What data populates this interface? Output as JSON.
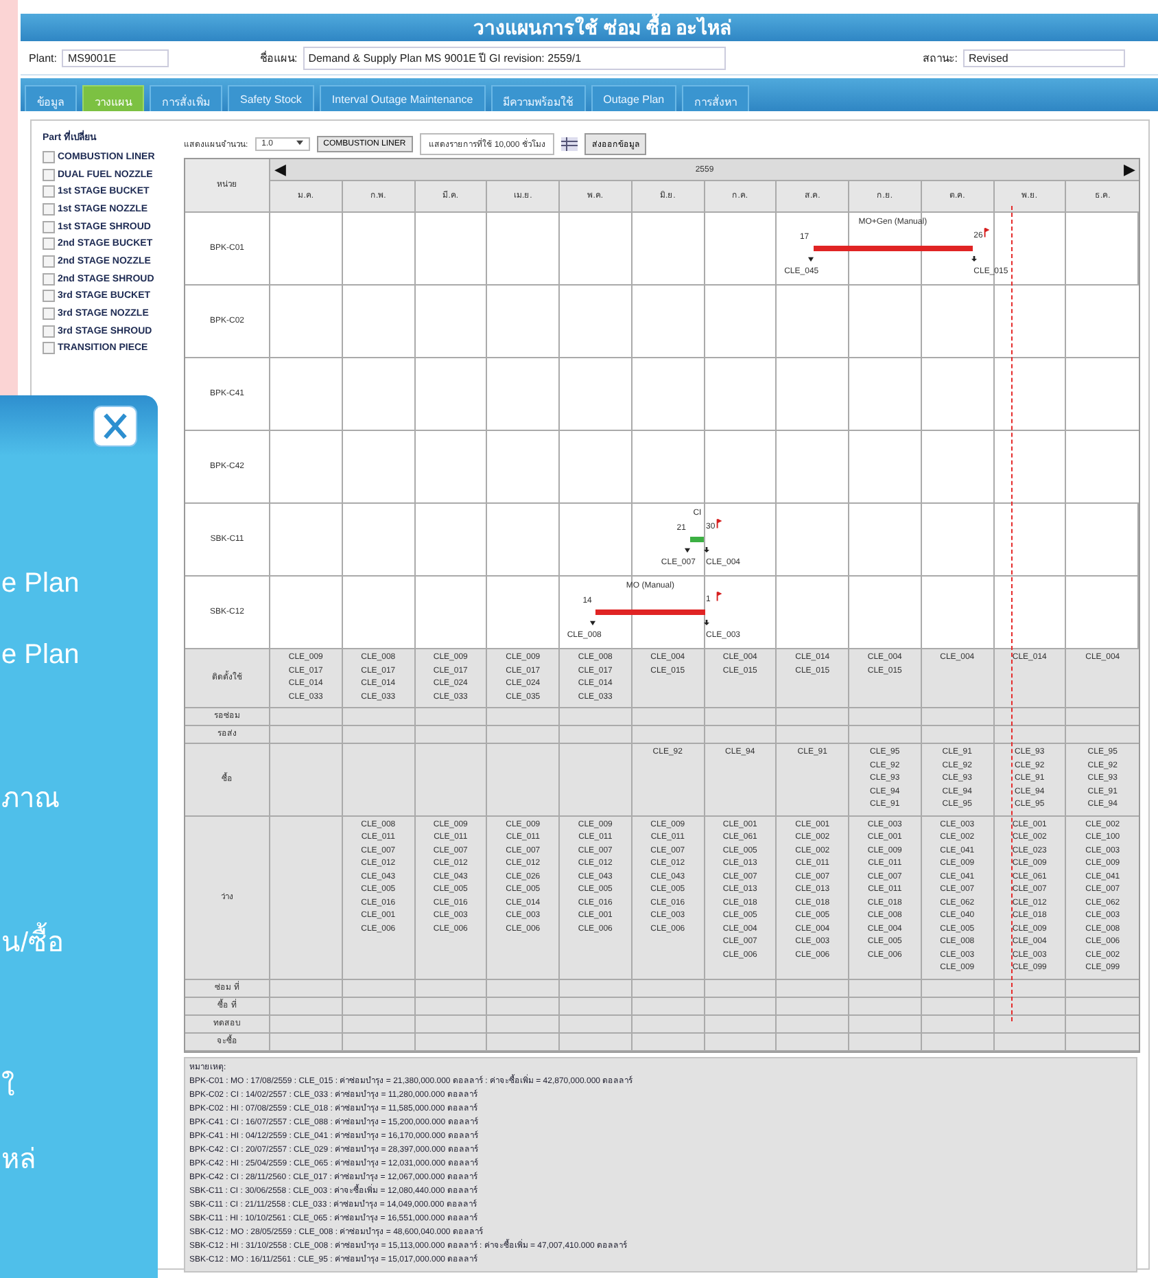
{
  "title": "วางแผนการใช้ ซ่อม ซื้อ อะไหล่",
  "info": {
    "plant_label": "Plant:",
    "plant": "MS9001E",
    "plan_label": "ชื่อแผน:",
    "plan": "Demand & Supply Plan MS 9001E ปี GI revision: 2559/1",
    "status_label": "สถานะ:",
    "status": "Revised"
  },
  "tabs": [
    {
      "label": "ข้อมูล",
      "selected": false
    },
    {
      "label": "วางแผน",
      "selected": true
    },
    {
      "label": "การสั่งเพิ่ม",
      "selected": false
    },
    {
      "label": "Safety Stock",
      "selected": false
    },
    {
      "label": "Interval Outage Maintenance",
      "selected": false
    },
    {
      "label": "มีความพร้อมใช้",
      "selected": false
    },
    {
      "label": "Outage Plan",
      "selected": false
    },
    {
      "label": "การสั่งหา",
      "selected": false
    }
  ],
  "parts": {
    "title": "Part ที่เปลี่ยน",
    "items": [
      {
        "label": "COMBUSTION LINER",
        "checked": false
      },
      {
        "label": "DUAL FUEL NOZZLE",
        "checked": false
      },
      {
        "label": "1st STAGE BUCKET",
        "checked": false
      },
      {
        "label": "1st STAGE NOZZLE",
        "checked": false
      },
      {
        "label": "1st STAGE SHROUD",
        "checked": false
      },
      {
        "label": "2nd STAGE BUCKET",
        "checked": false
      },
      {
        "label": "2nd STAGE NOZZLE",
        "checked": false
      },
      {
        "label": "2nd STAGE SHROUD",
        "checked": false
      },
      {
        "label": "3rd STAGE BUCKET",
        "checked": false
      },
      {
        "label": "3rd STAGE NOZZLE",
        "checked": false
      },
      {
        "label": "3rd STAGE SHROUD",
        "checked": false
      },
      {
        "label": "TRANSITION PIECE",
        "checked": false
      }
    ]
  },
  "toolbar": {
    "count_label": "แสดงแผนจำนวน:",
    "count": "1.0",
    "part_button": "COMBUSTION LINER",
    "hours_field": "แสดงรายการที่ใช้ 10,000 ชั่วโมง",
    "export_button": "ส่งออกข้อมูล"
  },
  "grid": {
    "unit_header": "หน่วย",
    "prev": "◀",
    "next": "▶",
    "year": "2559",
    "months": [
      {
        "label": "ม.ค.",
        "today": false
      },
      {
        "label": "ก.พ.",
        "today": false
      },
      {
        "label": "มี.ค.",
        "today": false
      },
      {
        "label": "เม.ย.",
        "today": false
      },
      {
        "label": "พ.ค.",
        "today": false
      },
      {
        "label": "มิ.ย.",
        "today": false
      },
      {
        "label": "ก.ค.",
        "today": false
      },
      {
        "label": "ส.ค.",
        "today": false
      },
      {
        "label": "ก.ย.",
        "today": false
      },
      {
        "label": "ต.ค.",
        "today": false
      },
      {
        "label": "พ.ย.",
        "today": true
      },
      {
        "label": "ธ.ค.",
        "today": false
      }
    ],
    "units": [
      {
        "name": "BPK-C01",
        "cells": [
          {
            "bar": false
          },
          {
            "bar": false
          },
          {
            "bar": false
          },
          {
            "bar": false
          },
          {
            "bar": false
          },
          {
            "bar": false
          },
          {
            "bar": false
          },
          {
            "bar": true
          },
          {
            "bar": true
          },
          {
            "bar": true
          },
          {
            "bar": false
          },
          {
            "bar": false
          }
        ],
        "bar": {
          "color": "#e02424",
          "title": "MO+Gen (Manual)",
          "start_day": "17",
          "end_day": "26",
          "start_code": "CLE_045",
          "end_code": "CLE_015"
        }
      },
      {
        "name": "BPK-C02",
        "cells": [
          {
            "bar": false
          },
          {
            "bar": false
          },
          {
            "bar": false
          },
          {
            "bar": false
          },
          {
            "bar": false
          },
          {
            "bar": false
          },
          {
            "bar": false
          },
          {
            "bar": false
          },
          {
            "bar": false
          },
          {
            "bar": false
          },
          {
            "bar": false
          },
          {
            "bar": false
          }
        ]
      },
      {
        "name": "BPK-C41",
        "cells": [
          {
            "bar": false
          },
          {
            "bar": false
          },
          {
            "bar": false
          },
          {
            "bar": false
          },
          {
            "bar": false
          },
          {
            "bar": false
          },
          {
            "bar": false
          },
          {
            "bar": false
          },
          {
            "bar": false
          },
          {
            "bar": false
          },
          {
            "bar": false
          },
          {
            "bar": false
          }
        ]
      },
      {
        "name": "BPK-C42",
        "cells": [
          {
            "bar": false
          },
          {
            "bar": false
          },
          {
            "bar": false
          },
          {
            "bar": false
          },
          {
            "bar": false
          },
          {
            "bar": false
          },
          {
            "bar": false
          },
          {
            "bar": false
          },
          {
            "bar": false
          },
          {
            "bar": false
          },
          {
            "bar": false
          },
          {
            "bar": false
          }
        ]
      },
      {
        "name": "SBK-C11",
        "cells": [
          {
            "bar": false
          },
          {
            "bar": false
          },
          {
            "bar": false
          },
          {
            "bar": false
          },
          {
            "bar": false
          },
          {
            "bar": true
          },
          {
            "bar": false
          },
          {
            "bar": false
          },
          {
            "bar": false
          },
          {
            "bar": false
          },
          {
            "bar": false
          },
          {
            "bar": false
          }
        ],
        "bar": {
          "color": "#3cb043",
          "title": "CI",
          "start_day": "21",
          "end_day": "30",
          "start_code": "CLE_007",
          "end_code": "CLE_004"
        }
      },
      {
        "name": "SBK-C12",
        "cells": [
          {
            "bar": false
          },
          {
            "bar": false
          },
          {
            "bar": false
          },
          {
            "bar": false
          },
          {
            "bar": true
          },
          {
            "bar": true
          },
          {
            "bar": false
          },
          {
            "bar": false
          },
          {
            "bar": false
          },
          {
            "bar": false
          },
          {
            "bar": false
          },
          {
            "bar": false
          }
        ],
        "bar": {
          "color": "#e02424",
          "title": "MO (Manual)",
          "start_day": "14",
          "end_day": "1",
          "start_code": "CLE_008",
          "end_code": "CLE_003"
        }
      }
    ],
    "summary_rows": [
      {
        "label": "ติดตั้งใช้",
        "cells": [
          {
            "codes": [
              "CLE_009",
              "CLE_017",
              "CLE_014",
              "CLE_033"
            ]
          },
          {
            "codes": [
              "CLE_008",
              "CLE_017",
              "CLE_014",
              "CLE_033"
            ]
          },
          {
            "codes": [
              "CLE_009",
              "CLE_017",
              "CLE_024",
              "CLE_033"
            ]
          },
          {
            "codes": [
              "CLE_009",
              "CLE_017",
              "CLE_024",
              "CLE_035"
            ]
          },
          {
            "codes": [
              "CLE_008",
              "CLE_017",
              "CLE_014",
              "CLE_033"
            ]
          },
          {
            "codes": [
              "CLE_004",
              "CLE_015"
            ]
          },
          {
            "codes": [
              "CLE_004",
              "CLE_015"
            ]
          },
          {
            "codes": [
              "CLE_014",
              "CLE_015"
            ]
          },
          {
            "codes": [
              "CLE_004",
              "CLE_015"
            ]
          },
          {
            "codes": [
              "CLE_004"
            ]
          },
          {
            "codes": [
              "CLE_014"
            ]
          },
          {
            "codes": [
              "CLE_004"
            ]
          }
        ]
      },
      {
        "label": "รอซ่อม"
      },
      {
        "label": "รอส่ง"
      },
      {
        "label": "ซื้อ",
        "cells": [
          null,
          null,
          null,
          null,
          null,
          {
            "codes": [
              "CLE_92"
            ]
          },
          {
            "codes": [
              "CLE_94"
            ]
          },
          {
            "codes": [
              "CLE_91"
            ]
          },
          {
            "codes": [
              "CLE_95",
              "CLE_92",
              "CLE_93",
              "CLE_94",
              "CLE_91"
            ]
          },
          {
            "codes": [
              "CLE_91",
              "CLE_92",
              "CLE_93",
              "CLE_94",
              "CLE_95"
            ]
          },
          {
            "codes": [
              "CLE_93",
              "CLE_92",
              "CLE_91",
              "CLE_94",
              "CLE_95"
            ]
          },
          {
            "codes": [
              "CLE_95",
              "CLE_92",
              "CLE_93",
              "CLE_91",
              "CLE_94"
            ]
          }
        ]
      },
      {
        "label": "ว่าง",
        "cells": [
          null,
          {
            "codes": [
              "CLE_008",
              "CLE_011",
              "CLE_007",
              "CLE_012",
              "CLE_043",
              "CLE_005",
              "CLE_016",
              "CLE_001",
              "CLE_006"
            ]
          },
          {
            "codes": [
              "CLE_009",
              "CLE_011",
              "CLE_007",
              "CLE_012",
              "CLE_043",
              "CLE_005",
              "CLE_016",
              "CLE_003",
              "CLE_006"
            ]
          },
          {
            "codes": [
              "CLE_009",
              "CLE_011",
              "CLE_007",
              "CLE_012",
              "CLE_026",
              "CLE_005",
              "CLE_014",
              "CLE_003",
              "CLE_006"
            ]
          },
          {
            "codes": [
              "CLE_009",
              "CLE_011",
              "CLE_007",
              "CLE_012",
              "CLE_043",
              "CLE_005",
              "CLE_016",
              "CLE_001",
              "CLE_006"
            ]
          },
          {
            "codes": [
              "CLE_009",
              "CLE_011",
              "CLE_007",
              "CLE_012",
              "CLE_043",
              "CLE_005",
              "CLE_016",
              "CLE_003",
              "CLE_006"
            ]
          },
          {
            "codes": [
              "CLE_001",
              "CLE_061",
              "CLE_005",
              "CLE_013",
              "CLE_007",
              "CLE_013",
              "CLE_018",
              "CLE_005",
              "CLE_004",
              "CLE_007",
              "CLE_006"
            ]
          },
          {
            "codes": [
              "CLE_001",
              "CLE_002",
              "CLE_002",
              "CLE_011",
              "CLE_007",
              "CLE_013",
              "CLE_018",
              "CLE_005",
              "CLE_004",
              "CLE_003",
              "CLE_006"
            ]
          },
          {
            "codes": [
              "CLE_003",
              "CLE_001",
              "CLE_009",
              "CLE_011",
              "CLE_007",
              "CLE_011",
              "CLE_018",
              "CLE_008",
              "CLE_004",
              "CLE_005",
              "CLE_006"
            ]
          },
          {
            "codes": [
              "CLE_003",
              "CLE_002",
              "CLE_041",
              "CLE_009",
              "CLE_041",
              "CLE_007",
              "CLE_062",
              "CLE_040",
              "CLE_005",
              "CLE_008",
              "CLE_003",
              "CLE_009"
            ]
          },
          {
            "codes": [
              "CLE_001",
              "CLE_002",
              "CLE_023",
              "CLE_009",
              "CLE_061",
              "CLE_007",
              "CLE_012",
              "CLE_018",
              "CLE_009",
              "CLE_004",
              "CLE_003",
              "CLE_099"
            ]
          },
          {
            "codes": [
              "CLE_002",
              "CLE_100",
              "CLE_003",
              "CLE_009",
              "CLE_041",
              "CLE_007",
              "CLE_062",
              "CLE_003",
              "CLE_008",
              "CLE_006",
              "CLE_002",
              "CLE_099"
            ]
          }
        ]
      },
      {
        "label": "ซ่อม ที่"
      },
      {
        "label": "ซื้อ ที่"
      },
      {
        "label": "ทดสอบ"
      },
      {
        "label": "จะซื้อ"
      }
    ]
  },
  "notes": {
    "title": "หมายเหตุ:",
    "lines": [
      "BPK-C01 : MO : 17/08/2559 : CLE_015 : ค่าซ่อมบำรุง = 21,380,000.000 ดอลลาร์ : ค่าจะซื้อเพิ่ม = 42,870,000.000 ดอลลาร์",
      "BPK-C02 : CI : 14/02/2557 : CLE_033 : ค่าซ่อมบำรุง = 11,280,000.000 ดอลลาร์",
      "BPK-C02 : HI : 07/08/2559 : CLE_018 : ค่าซ่อมบำรุง = 11,585,000.000 ดอลลาร์",
      "BPK-C41 : CI : 16/07/2557 : CLE_088 : ค่าซ่อมบำรุง = 15,200,000.000 ดอลลาร์",
      "BPK-C41 : HI : 04/12/2559 : CLE_041 : ค่าซ่อมบำรุง = 16,170,000.000 ดอลลาร์",
      "BPK-C42 : CI : 20/07/2557 : CLE_029 : ค่าซ่อมบำรุง = 28,397,000.000 ดอลลาร์",
      "BPK-C42 : HI : 25/04/2559 : CLE_065 : ค่าซ่อมบำรุง = 12,031,000.000 ดอลลาร์",
      "BPK-C42 : CI : 28/11/2560 : CLE_017 : ค่าซ่อมบำรุง = 12,067,000.000 ดอลลาร์",
      "SBK-C11 : CI : 30/06/2558 : CLE_003 : ค่าจะซื้อเพิ่ม = 12,080,440.000 ดอลลาร์",
      "SBK-C11 : CI : 21/11/2558 : CLE_033 : ค่าซ่อมบำรุง = 14,049,000.000 ดอลลาร์",
      "SBK-C11 : HI : 10/10/2561 : CLE_065 : ค่าซ่อมบำรุง = 16,551,000.000 ดอลลาร์",
      "SBK-C12 : MO : 28/05/2559 : CLE_008 : ค่าซ่อมบำรุง = 48,600,040.000 ดอลลาร์",
      "SBK-C12 : HI : 31/10/2558 : CLE_008 : ค่าซ่อมบำรุง = 15,113,000.000 ดอลลาร์ : ค่าจะซื้อเพิ่ม = 47,007,410.000 ดอลลาร์",
      "SBK-C12 : MO : 16/11/2561 : CLE_95 : ค่าซ่อมบำรุง = 15,017,000.000 ดอลลาร์"
    ]
  },
  "side_menu": {
    "items": [
      {
        "kind": "spacer"
      },
      {
        "kind": "text",
        "label": "e Plan"
      },
      {
        "kind": "text",
        "label": "e Plan"
      },
      {
        "kind": "spacer"
      },
      {
        "kind": "text",
        "label": "ภาณ"
      },
      {
        "kind": "spacer"
      },
      {
        "kind": "text",
        "label": "น/ซื้อ"
      },
      {
        "kind": "spacer"
      },
      {
        "kind": "text",
        "label": "ใ"
      },
      {
        "kind": "text",
        "label": "หล่"
      }
    ]
  }
}
